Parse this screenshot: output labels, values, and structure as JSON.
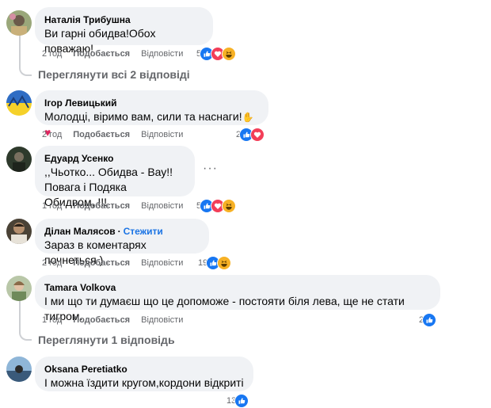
{
  "comments": [
    {
      "author": "Наталія Трибушна",
      "text": "Ви гарні обидва!Обох поважаю!",
      "time": "2 год",
      "like": "Подобається",
      "reply": "Відповісти",
      "react_count": "5"
    },
    {
      "author": "Ігор Левицький",
      "text": "Молодці, віримо вам, сили та наснаги!",
      "time": "2 год",
      "like": "Подобається",
      "reply": "Відповісти",
      "react_count": "2"
    },
    {
      "author": "Едуард Усенко",
      "text": ",,Чьотко... Обидва - Вау!!\nПовага і Подяка Обидвом,,!!!",
      "time": "1 год",
      "like": "Подобається",
      "reply": "Відповісти",
      "react_count": "5",
      "more": "···"
    },
    {
      "author": "Ділан Малясов",
      "follow": "Стежити",
      "text": "Зараз в коментарях почнеться )",
      "time": "2 год",
      "like": "Подобається",
      "reply": "Відповісти",
      "react_count": "19"
    },
    {
      "author": "Tamara Volkova",
      "text": "І ми що ти думаєш що це допоможе - постояти біля лева, ще не стати тигром.",
      "time": "1 год",
      "like": "Подобається",
      "reply": "Відповісти",
      "react_count": "2"
    },
    {
      "author": "Oksana Peretiatko",
      "text": "І можна їздити кругом,кордони відкриті",
      "time": "",
      "like": "",
      "reply": "",
      "react_count": "13"
    }
  ],
  "view_replies": [
    "Переглянути всі 2 відповіді",
    "Переглянути 1 відповідь"
  ],
  "colors": {
    "like_blue": "#1877f2",
    "love_red": "#f33e58",
    "haha_yellow": "#f7b125",
    "bubble": "#f0f2f5",
    "meta": "#65676b"
  }
}
